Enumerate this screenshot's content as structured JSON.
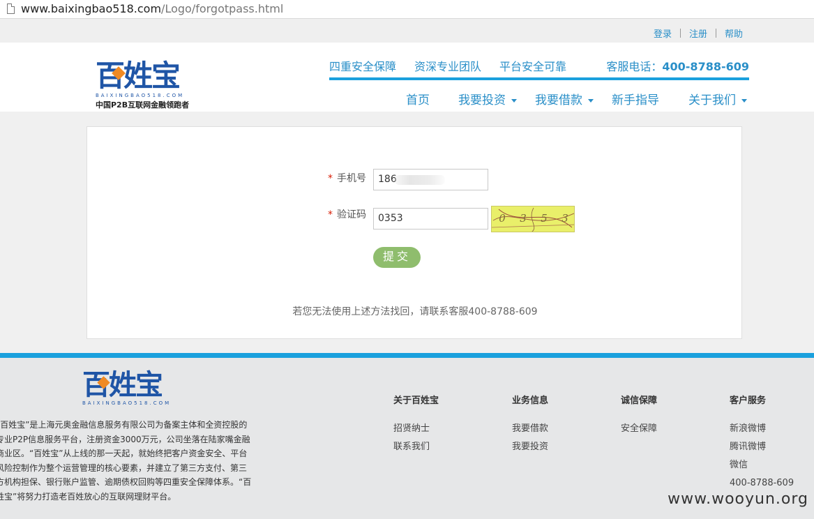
{
  "browser": {
    "url_host": "www.baixingbao518.com",
    "url_path": "/Logo/forgotpass.html"
  },
  "toplinks": [
    "登录",
    "注册",
    "帮助"
  ],
  "header": {
    "logo_word": "百姓宝",
    "logo_pinyin": "BAIXINGBAO518.COM",
    "logo_slogan": "中国P2B互联网金融领跑者",
    "features": [
      "四重安全保障",
      "资深专业团队",
      "平台安全可靠"
    ],
    "hotline_label": "客服电话：",
    "hotline_number": "400-8788-609"
  },
  "nav": [
    {
      "label": "首页",
      "dropdown": false
    },
    {
      "label": "我要投资",
      "dropdown": true
    },
    {
      "label": "我要借款",
      "dropdown": true
    },
    {
      "label": "新手指导",
      "dropdown": false
    },
    {
      "label": "关于我们",
      "dropdown": true
    }
  ],
  "form": {
    "required_mark": "*",
    "phone_label": "手机号",
    "phone_value": "186",
    "captcha_label": "验证码",
    "captcha_value": "0353",
    "captcha_digits": [
      "0",
      "3",
      "5",
      "3"
    ],
    "submit_label": "提交",
    "help_text": "若您无法使用上述方法找回，请联系客服400-8788-609"
  },
  "footer": {
    "logo_word": "百姓宝",
    "logo_pinyin": "BAIXINGBAO518.COM",
    "about_text": "“百姓宝”是上海元奥金融信息服务有限公司为备案主体和全资控股的专业P2P信息服务平台，注册资金3000万元，公司坐落在陆家嘴金融商业区。“百姓宝”从上线的那一天起，就始终把客户资金安全、平台风险控制作为整个运营管理的核心要素，并建立了第三方支付、第三方机构担保、银行账户监管、逾期债权回购等四重安全保障体系。“百姓宝”将努力打造老百姓放心的互联网理财平台。",
    "columns": [
      {
        "title": "关于百姓宝",
        "links": [
          "招贤纳士",
          "联系我们"
        ]
      },
      {
        "title": "业务信息",
        "links": [
          "我要借款",
          "我要投资"
        ]
      },
      {
        "title": "诚信保障",
        "links": [
          "安全保障"
        ]
      },
      {
        "title": "客户服务",
        "links": [
          "新浪微博",
          "腾讯微博",
          "微信",
          "400-8788-609"
        ]
      }
    ],
    "watermark": "www.wooyun.org"
  },
  "colors": {
    "brand_blue": "#1f55a6",
    "link_blue": "#2a8fc8",
    "accent_line": "#1aa0dd",
    "submit_green": "#8fbd6d",
    "logo_orange": "#f08a24"
  }
}
